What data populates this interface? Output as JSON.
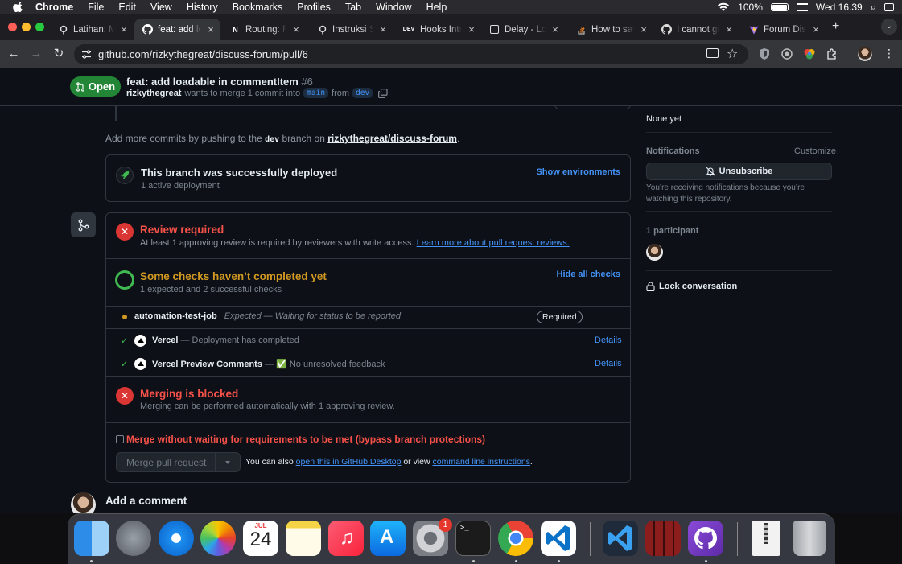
{
  "menubar": {
    "app_name": "Chrome",
    "items": [
      "File",
      "Edit",
      "View",
      "History",
      "Bookmarks",
      "Profiles",
      "Tab",
      "Window",
      "Help"
    ],
    "battery": "100%",
    "clock": "Wed 16.39"
  },
  "tabs": [
    {
      "title": "Latihan: Me",
      "icon": "dicoding-icon"
    },
    {
      "title": "feat: add lo",
      "icon": "github-icon"
    },
    {
      "title": "Routing: Re",
      "icon": "nextjs-icon"
    },
    {
      "title": "Instruksi Su",
      "icon": "dicoding-icon"
    },
    {
      "title": "Hooks Intro",
      "icon": "dev-icon"
    },
    {
      "title": "Delay - Loa",
      "icon": "doc-icon"
    },
    {
      "title": "How to sav",
      "icon": "stackoverflow-icon"
    },
    {
      "title": "I cannot gi",
      "icon": "github-icon"
    },
    {
      "title": "Forum Disk",
      "icon": "vite-icon"
    }
  ],
  "address": {
    "url": "github.com/rizkythegreat/discuss-forum/pull/6"
  },
  "pr": {
    "status": "Open",
    "title": "feat: add loadable in commentItem",
    "number": "#6",
    "author": "rizkythegreat",
    "merge_text": "wants to merge 1 commit into",
    "base_branch": "main",
    "from_text": "from",
    "head_branch": "dev"
  },
  "timeline": {
    "push_hint_prefix": "Add more commits by pushing to the",
    "push_hint_branch": "dev",
    "push_hint_mid": "branch on",
    "push_hint_repo": "rizkythegreat/discuss-forum",
    "push_hint_suffix": "."
  },
  "deploy": {
    "title": "This branch was successfully deployed",
    "subtitle": "1 active deployment",
    "action": "Show environments"
  },
  "review": {
    "title": "Review required",
    "text": "At least 1 approving review is required by reviewers with write access.",
    "link": "Learn more about pull request reviews."
  },
  "checks": {
    "title": "Some checks haven’t completed yet",
    "subtitle": "1 expected and 2 successful checks",
    "action": "Hide all checks",
    "items": [
      {
        "name": "automation-test-job",
        "desc": "Expected — Waiting for status to be reported",
        "badge": "Required"
      },
      {
        "name": "Vercel",
        "desc": "— Deployment has completed",
        "action": "Details"
      },
      {
        "name": "Vercel Preview Comments",
        "desc": "— ✅ No unresolved feedback",
        "action": "Details"
      }
    ]
  },
  "merge": {
    "title": "Merging is blocked",
    "text": "Merging can be performed automatically with 1 approving review.",
    "bypass_label": "Merge without waiting for requirements to be met (bypass branch protections)",
    "button": "Merge pull request",
    "alt_prefix": "You can also",
    "alt_link1": "open this in GitHub Desktop",
    "alt_mid": "or view",
    "alt_link2": "command line instructions",
    "alt_suffix": "."
  },
  "comment": {
    "label": "Add a comment"
  },
  "sidebar": {
    "labels_value": "None yet",
    "notifications_title": "Notifications",
    "customize": "Customize",
    "unsubscribe": "Unsubscribe",
    "notif_text": "You’re receiving notifications because you’re watching this repository.",
    "participants_title": "1 participant",
    "lock": "Lock conversation"
  },
  "dock": {
    "calendar_month": "JUL",
    "calendar_day": "24",
    "settings_badge": "1"
  },
  "colors": {
    "accent": "#4493f8",
    "open_green": "#238636",
    "danger": "#da3633",
    "warning": "#d29922",
    "success": "#3fb950"
  }
}
